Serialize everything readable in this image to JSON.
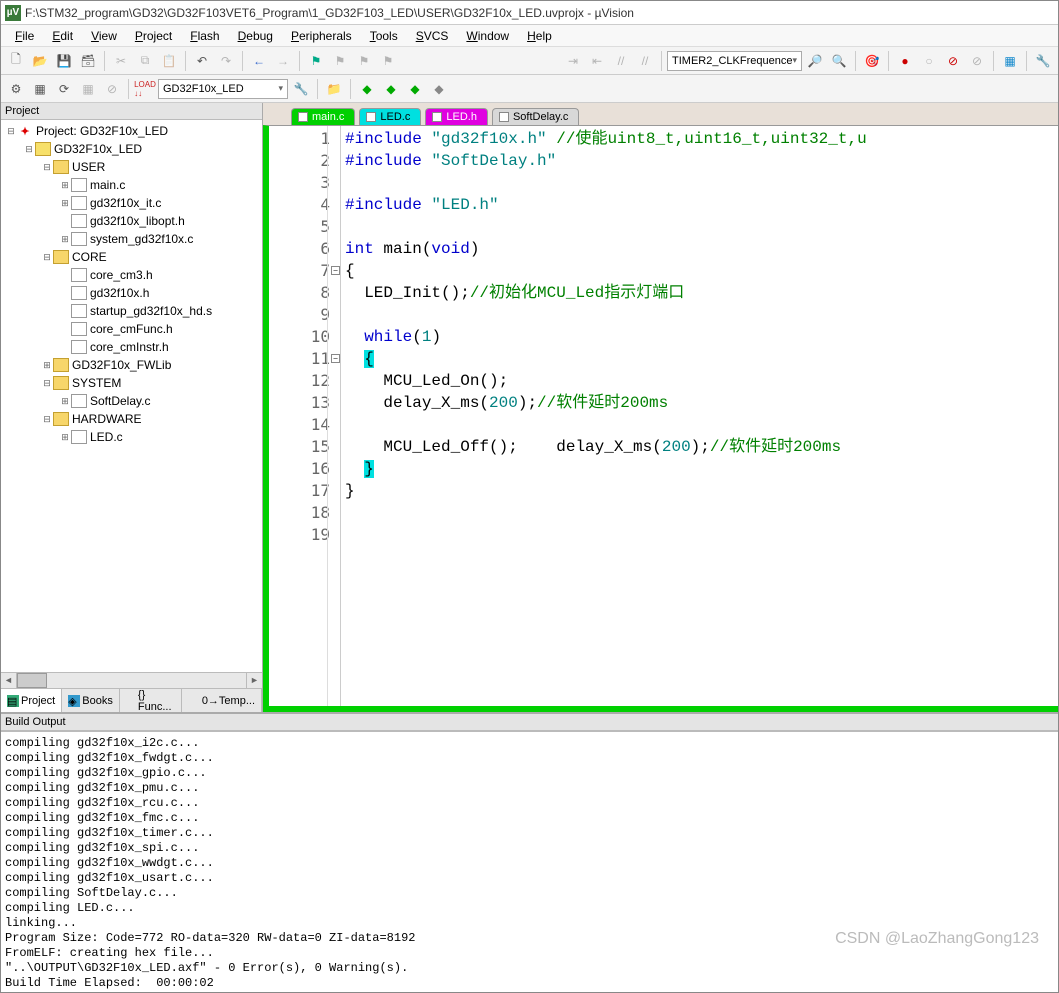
{
  "title": "F:\\STM32_program\\GD32\\GD32F103VET6_Program\\1_GD32F103_LED\\USER\\GD32F10x_LED.uvprojx - µVision",
  "menu": [
    "File",
    "Edit",
    "View",
    "Project",
    "Flash",
    "Debug",
    "Peripherals",
    "Tools",
    "SVCS",
    "Window",
    "Help"
  ],
  "toolbar2_combo": "GD32F10x_LED",
  "toolbar1_combo": "TIMER2_CLKFrequence",
  "project_panel": {
    "title": "Project"
  },
  "tree": [
    {
      "lvl": 0,
      "tw": "-",
      "icon": "proj",
      "label": "Project: GD32F10x_LED"
    },
    {
      "lvl": 1,
      "tw": "-",
      "icon": "target",
      "label": "GD32F10x_LED"
    },
    {
      "lvl": 2,
      "tw": "-",
      "icon": "folder",
      "label": "USER"
    },
    {
      "lvl": 3,
      "tw": "+",
      "icon": "file",
      "label": "main.c"
    },
    {
      "lvl": 3,
      "tw": "+",
      "icon": "file",
      "label": "gd32f10x_it.c"
    },
    {
      "lvl": 3,
      "tw": "",
      "icon": "file",
      "label": "gd32f10x_libopt.h"
    },
    {
      "lvl": 3,
      "tw": "+",
      "icon": "file",
      "label": "system_gd32f10x.c"
    },
    {
      "lvl": 2,
      "tw": "-",
      "icon": "folder",
      "label": "CORE"
    },
    {
      "lvl": 3,
      "tw": "",
      "icon": "file",
      "label": "core_cm3.h"
    },
    {
      "lvl": 3,
      "tw": "",
      "icon": "file",
      "label": "gd32f10x.h"
    },
    {
      "lvl": 3,
      "tw": "",
      "icon": "file",
      "label": "startup_gd32f10x_hd.s"
    },
    {
      "lvl": 3,
      "tw": "",
      "icon": "file",
      "label": "core_cmFunc.h"
    },
    {
      "lvl": 3,
      "tw": "",
      "icon": "file",
      "label": "core_cmInstr.h"
    },
    {
      "lvl": 2,
      "tw": "+",
      "icon": "folder",
      "label": "GD32F10x_FWLib"
    },
    {
      "lvl": 2,
      "tw": "-",
      "icon": "folder",
      "label": "SYSTEM"
    },
    {
      "lvl": 3,
      "tw": "+",
      "icon": "file",
      "label": "SoftDelay.c"
    },
    {
      "lvl": 2,
      "tw": "-",
      "icon": "folder",
      "label": "HARDWARE"
    },
    {
      "lvl": 3,
      "tw": "+",
      "icon": "file",
      "label": "LED.c"
    }
  ],
  "bottom_tabs": [
    {
      "label": "Project",
      "active": true
    },
    {
      "label": "Books"
    },
    {
      "label": "{} Func..."
    },
    {
      "label": "0→Temp..."
    }
  ],
  "editor_tabs": [
    {
      "label": "main.c",
      "cls": "active"
    },
    {
      "label": "LED.c",
      "cls": "cyan"
    },
    {
      "label": "LED.h",
      "cls": "magenta"
    },
    {
      "label": "SoftDelay.c",
      "cls": "gray"
    }
  ],
  "code_lines": [
    {
      "n": 1,
      "seg": [
        {
          "t": "#include ",
          "c": "pp"
        },
        {
          "t": "\"gd32f10x.h\"",
          "c": "str"
        },
        {
          "t": " //使能uint8_t,uint16_t,uint32_t,u",
          "c": "cm"
        }
      ]
    },
    {
      "n": 2,
      "seg": [
        {
          "t": "#include ",
          "c": "pp"
        },
        {
          "t": "\"SoftDelay.h\"",
          "c": "str"
        }
      ]
    },
    {
      "n": 3,
      "seg": []
    },
    {
      "n": 4,
      "seg": [
        {
          "t": "#include ",
          "c": "pp"
        },
        {
          "t": "\"LED.h\"",
          "c": "str"
        }
      ]
    },
    {
      "n": 5,
      "seg": []
    },
    {
      "n": 6,
      "seg": [
        {
          "t": "int",
          "c": "kw"
        },
        {
          "t": " main("
        },
        {
          "t": "void",
          "c": "kw"
        },
        {
          "t": ")"
        }
      ]
    },
    {
      "n": 7,
      "fold": "-",
      "seg": [
        {
          "t": "{"
        }
      ]
    },
    {
      "n": 8,
      "seg": [
        {
          "t": "  LED_Init();"
        },
        {
          "t": "//初始化MCU_Led指示灯端口",
          "c": "cm"
        }
      ]
    },
    {
      "n": 9,
      "seg": []
    },
    {
      "n": 10,
      "seg": [
        {
          "t": "  "
        },
        {
          "t": "while",
          "c": "kw"
        },
        {
          "t": "("
        },
        {
          "t": "1",
          "c": "num"
        },
        {
          "t": ")"
        }
      ]
    },
    {
      "n": 11,
      "fold": "-",
      "seg": [
        {
          "t": "  "
        },
        {
          "t": "{",
          "c": "hl"
        }
      ]
    },
    {
      "n": 12,
      "seg": [
        {
          "t": "    MCU_Led_On();"
        }
      ]
    },
    {
      "n": 13,
      "seg": [
        {
          "t": "    delay_X_ms("
        },
        {
          "t": "200",
          "c": "num"
        },
        {
          "t": ");"
        },
        {
          "t": "//软件延时200ms",
          "c": "cm"
        }
      ]
    },
    {
      "n": 14,
      "seg": []
    },
    {
      "n": 15,
      "seg": [
        {
          "t": "    MCU_Led_Off();    delay_X_ms("
        },
        {
          "t": "200",
          "c": "num"
        },
        {
          "t": ");"
        },
        {
          "t": "//软件延时200ms",
          "c": "cm"
        }
      ]
    },
    {
      "n": 16,
      "seg": [
        {
          "t": "  "
        },
        {
          "t": "}",
          "c": "hl"
        }
      ]
    },
    {
      "n": 17,
      "seg": [
        {
          "t": "}"
        }
      ]
    },
    {
      "n": 18,
      "seg": []
    },
    {
      "n": 19,
      "seg": []
    }
  ],
  "build_panel": {
    "title": "Build Output"
  },
  "build_output": "compiling gd32f10x_i2c.c...\ncompiling gd32f10x_fwdgt.c...\ncompiling gd32f10x_gpio.c...\ncompiling gd32f10x_pmu.c...\ncompiling gd32f10x_rcu.c...\ncompiling gd32f10x_fmc.c...\ncompiling gd32f10x_timer.c...\ncompiling gd32f10x_spi.c...\ncompiling gd32f10x_wwdgt.c...\ncompiling gd32f10x_usart.c...\ncompiling SoftDelay.c...\ncompiling LED.c...\nlinking...\nProgram Size: Code=772 RO-data=320 RW-data=0 ZI-data=8192\nFromELF: creating hex file...\n\"..\\OUTPUT\\GD32F10x_LED.axf\" - 0 Error(s), 0 Warning(s).\nBuild Time Elapsed:  00:00:02",
  "watermark": "CSDN @LaoZhangGong123"
}
